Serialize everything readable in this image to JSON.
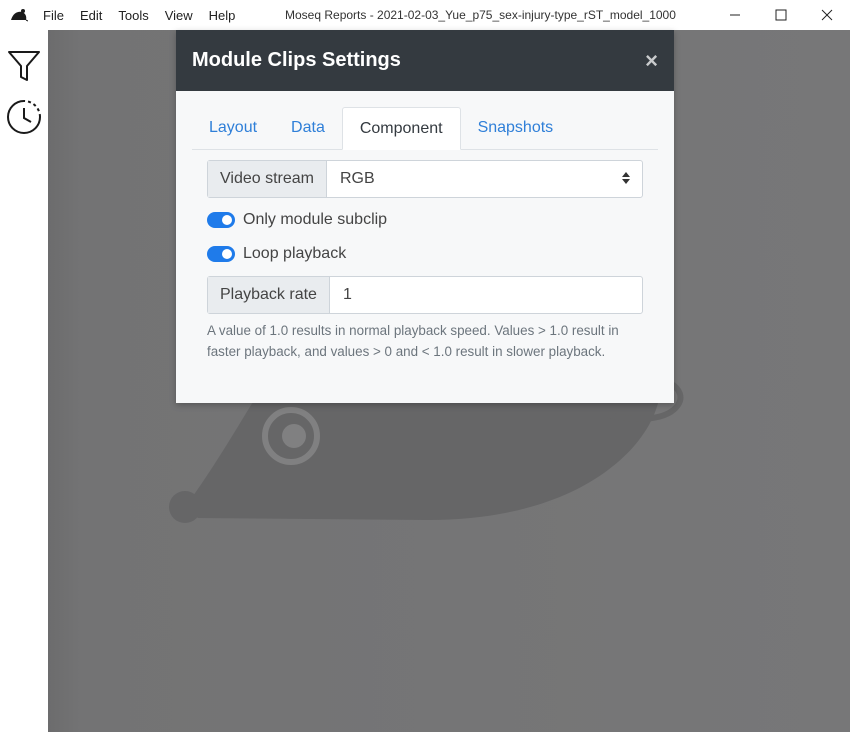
{
  "menu": {
    "items": [
      "File",
      "Edit",
      "Tools",
      "View",
      "Help"
    ]
  },
  "window": {
    "title": "Moseq Reports - 2021-02-03_Yue_p75_sex-injury-type_rST_model_1000"
  },
  "sidebar": {
    "icons": [
      "filter-icon",
      "history-icon"
    ]
  },
  "modal": {
    "title": "Module Clips Settings",
    "close_label": "×",
    "tabs": [
      {
        "label": "Layout",
        "active": false
      },
      {
        "label": "Data",
        "active": false
      },
      {
        "label": "Component",
        "active": true
      },
      {
        "label": "Snapshots",
        "active": false
      }
    ],
    "video_stream": {
      "label": "Video stream",
      "value": "RGB"
    },
    "toggles": [
      {
        "label": "Only module subclip",
        "checked": true
      },
      {
        "label": "Loop playback",
        "checked": true
      }
    ],
    "playback_rate": {
      "label": "Playback rate",
      "value": "1"
    },
    "help_text": "A value of 1.0 results in normal playback speed. Values > 1.0 result in faster playback, and values > 0 and < 1.0 result in slower playback."
  },
  "colors": {
    "accent": "#1f7bea",
    "header": "#343a40",
    "backdrop": "#767677"
  }
}
